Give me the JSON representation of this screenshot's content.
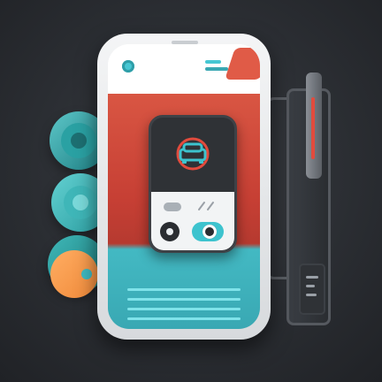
{
  "colors": {
    "background": "#2b2e33",
    "teal": "#46c7d3",
    "red": "#c63f34",
    "orange": "#f08a3a",
    "dark": "#2f3236",
    "light": "#f2f4f5"
  },
  "icons": {
    "disc_top": "teal-disc-icon",
    "disc_middle": "teal-disc-icon",
    "disc_bottom": "orange-teal-disc-icon",
    "center": "car-icon",
    "mechanism": "slider-rail-icon"
  },
  "controls": {
    "toggle_on": true
  }
}
